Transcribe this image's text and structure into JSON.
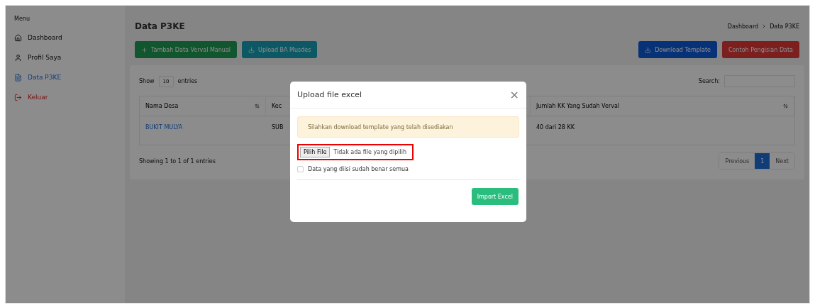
{
  "sidebar": {
    "heading": "Menu",
    "items": [
      {
        "label": "Dashboard",
        "kind": "home",
        "selected": false
      },
      {
        "label": "Profil Saya",
        "kind": "user",
        "selected": false
      },
      {
        "label": "Data P3KE",
        "kind": "file",
        "selected": true
      },
      {
        "label": "Keluar",
        "kind": "logout",
        "selected": false
      }
    ]
  },
  "page": {
    "title": "Data P3KE",
    "breadcrumb": [
      "Dashboard",
      "Data P3KE"
    ],
    "left_buttons": [
      {
        "label": "Tambah Data Verval Manual",
        "kind": "add"
      },
      {
        "label": "Upload BA Musdes",
        "kind": "upload"
      }
    ],
    "right_buttons": [
      {
        "label": "Download Template",
        "kind": "download"
      },
      {
        "label": "Contoh Pengisian Data",
        "kind": "danger"
      }
    ]
  },
  "table": {
    "show_label": "Show",
    "page_size": "10",
    "entries_label": "entries",
    "search_label": "Search:",
    "columns": [
      "Nama Desa",
      "Kec",
      "Jumlah KK Yang Sudah Verval"
    ],
    "rows": [
      [
        "BUKIT MULYA",
        "SUB",
        "40 dari 28 KK"
      ]
    ],
    "info": "Showing 1 to 1 of 1 entries",
    "pagination": [
      {
        "label": "Previous",
        "selected": false,
        "disabled": true
      },
      {
        "label": "1",
        "selected": true,
        "disabled": false
      },
      {
        "label": "Next",
        "selected": false,
        "disabled": true
      }
    ]
  },
  "modal": {
    "title": "Upload file excel",
    "close": "×",
    "alert": "Silahkan download template yang telah disediakan",
    "file_button": "Pilih File",
    "file_status": "Tidak ada file yang dipilih",
    "highlighted": true,
    "checkbox": {
      "label": "Data yang diisi sudah benar semua",
      "checked": false
    },
    "submit": "Import Excel"
  }
}
